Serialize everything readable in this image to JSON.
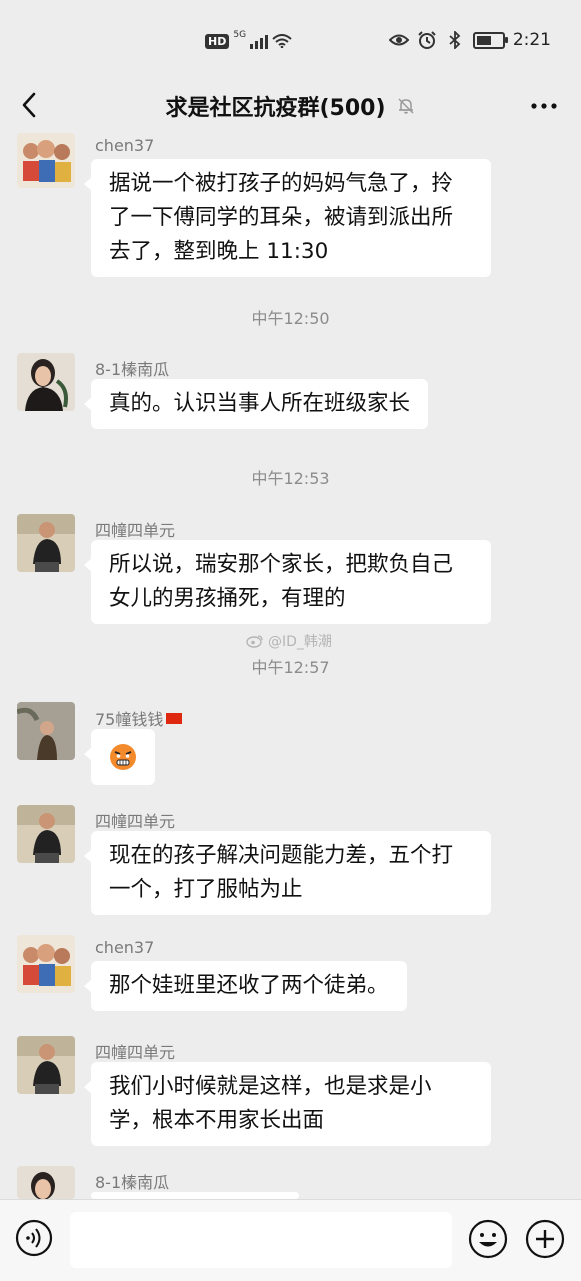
{
  "status_bar": {
    "hd": "HD",
    "signal_type": "5G",
    "time": "2:21",
    "battery_level": 0.6
  },
  "header": {
    "title": "求是社区抗疫群(500)",
    "back_icon": "chevron-left-icon",
    "more_icon": "more-dots-icon",
    "mute_icon": "bell-muted-icon"
  },
  "messages": [
    {
      "type": "msg",
      "sender": "chen37",
      "text": "据说一个被打孩子的妈妈气急了，拎了一下傅同学的耳朵，被请到派出所去了，整到晚上 11:30"
    },
    {
      "type": "time",
      "text": "中午12:50"
    },
    {
      "type": "msg",
      "sender": "8-1榛南瓜",
      "text": "真的。认识当事人所在班级家长"
    },
    {
      "type": "time",
      "text": "中午12:53"
    },
    {
      "type": "msg",
      "sender": "四幢四单元",
      "text": "所以说，瑞安那个家长，把欺负自己女儿的男孩捅死，有理的"
    },
    {
      "type": "time",
      "text": "中午12:57"
    },
    {
      "type": "msg",
      "sender": "75幢钱钱",
      "emoji": "angry-face-emoji"
    },
    {
      "type": "msg",
      "sender": "四幢四单元",
      "text": "现在的孩子解决问题能力差，五个打一个，打了服帖为止"
    },
    {
      "type": "msg",
      "sender": "chen37",
      "text": "那个娃班里还收了两个徒弟。"
    },
    {
      "type": "msg",
      "sender": "四幢四单元",
      "text": "我们小时候就是这样，也是求是小学，根本不用家长出面"
    },
    {
      "type": "msg",
      "sender": "8-1榛南瓜",
      "text": ""
    }
  ],
  "watermark": "@ID_韩潮",
  "bottom_bar": {
    "voice_icon": "voice-icon",
    "input_value": "",
    "emoji_icon": "emoji-icon",
    "plus_icon": "plus-icon"
  }
}
